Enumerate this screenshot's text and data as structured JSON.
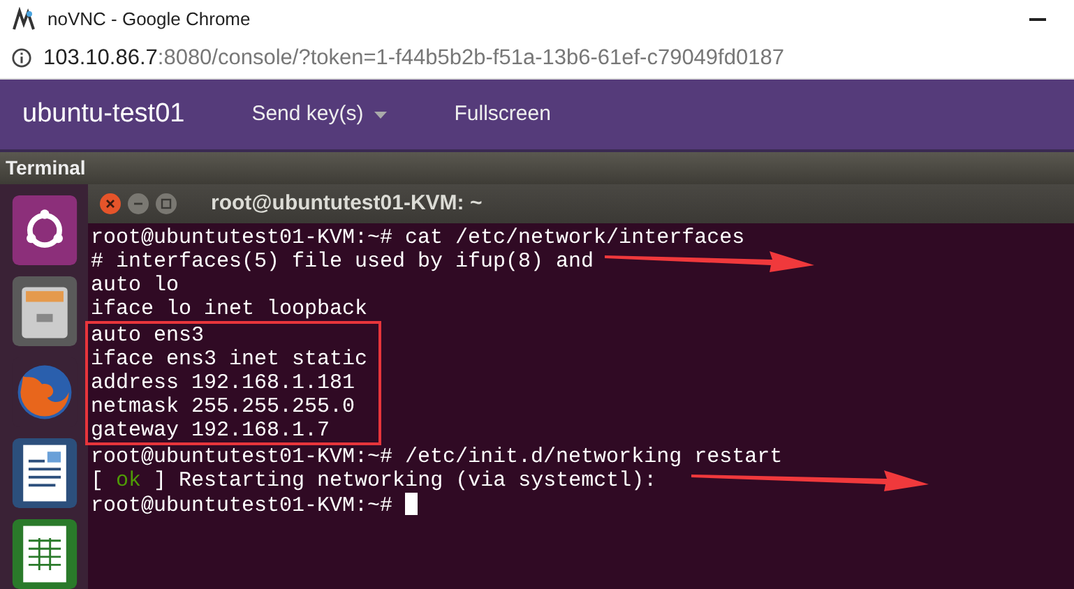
{
  "browser": {
    "title": "noVNC - Google Chrome",
    "url_host": "103.10.86.7",
    "url_rest": ":8080/console/?token=1-f44b5b2b-f51a-13b6-61ef-c79049fd0187"
  },
  "navbar": {
    "brand": "ubuntu-test01",
    "items": [
      {
        "label": "Send key(s)",
        "dropdown": true
      },
      {
        "label": "Fullscreen",
        "dropdown": false
      }
    ]
  },
  "panel": {
    "title": "Terminal"
  },
  "terminal": {
    "title": "root@ubuntutest01-KVM: ~",
    "lines": [
      {
        "kind": "text",
        "text": "root@ubuntutest01-KVM:~# cat /etc/network/interfaces",
        "highlighted": false,
        "arrow": false
      },
      {
        "kind": "text",
        "text": "# interfaces(5) file used by ifup(8) and",
        "highlighted": false,
        "arrow": true
      },
      {
        "kind": "text",
        "text": "auto lo",
        "highlighted": false,
        "arrow": false
      },
      {
        "kind": "text",
        "text": "iface lo inet loopback",
        "highlighted": false,
        "arrow": false
      },
      {
        "kind": "text",
        "text": "auto ens3",
        "highlighted": true,
        "arrow": false
      },
      {
        "kind": "text",
        "text": "iface ens3 inet static",
        "highlighted": true,
        "arrow": false
      },
      {
        "kind": "text",
        "text": "address 192.168.1.181",
        "highlighted": true,
        "arrow": false
      },
      {
        "kind": "text",
        "text": "netmask 255.255.255.0",
        "highlighted": true,
        "arrow": false
      },
      {
        "kind": "text",
        "text": "gateway 192.168.1.7",
        "highlighted": true,
        "arrow": false
      },
      {
        "kind": "text",
        "text": "root@ubuntutest01-KVM:~# /etc/init.d/networking restart",
        "highlighted": false,
        "arrow": false
      },
      {
        "kind": "status",
        "open": "[",
        "status": "ok",
        "text": "] Restarting networking (via systemctl):",
        "highlighted": false,
        "arrow": true
      },
      {
        "kind": "prompt",
        "text": "root@ubuntutest01-KVM:~#",
        "cursor": true,
        "highlighted": false,
        "arrow": false
      }
    ]
  }
}
